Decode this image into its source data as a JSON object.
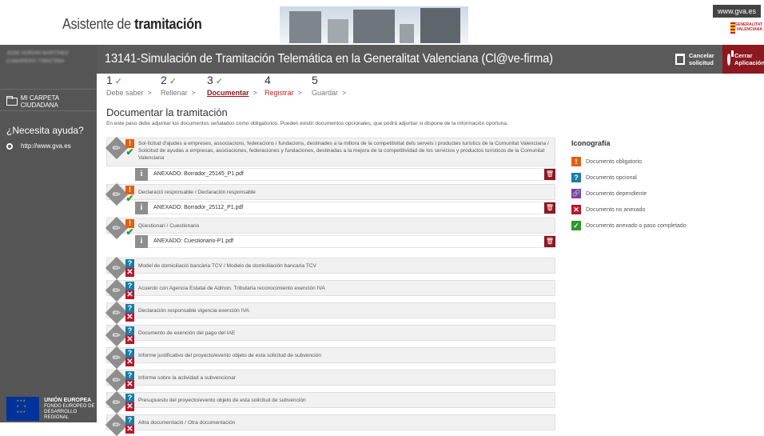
{
  "header": {
    "title_prefix": "Asistente de ",
    "title_bold": "tramitación",
    "gva_link": "www.gva.es",
    "gva_logo_line1": "GENERALITAT",
    "gva_logo_line2": "VALENCIANA"
  },
  "sidebar": {
    "user_name": "JOSE ADRIAN MARTINEZ CAMARERO 73942785A",
    "folder_label": "MI CARPETA CIUDADANA",
    "help_title": "¿Necesita ayuda?",
    "help_link": "http://www.gva.es",
    "eu_title": "UNIÓN EUROPEA",
    "eu_line1": "FONDO EUROPEO DE",
    "eu_line2": "DESARROLLO REGIONAL"
  },
  "titlebar": {
    "title": "13141-Simulación de Tramitación Telemática en la Generalitat Valenciana (Cl@ve-firma)",
    "cancel_line1": "Cancelar",
    "cancel_line2": "solicitud",
    "close_line1": "Cerrar",
    "close_line2": "Aplicación"
  },
  "steps": [
    {
      "num": "1",
      "check": "✓",
      "label": "Debe saber",
      "state": "done"
    },
    {
      "num": "2",
      "check": "✓",
      "label": "Rellenar",
      "state": "done"
    },
    {
      "num": "3",
      "check": "✓",
      "label": "Documentar",
      "state": "active"
    },
    {
      "num": "4",
      "check": "",
      "label": "Registrar",
      "state": "next"
    },
    {
      "num": "5",
      "check": "",
      "label": "Guardar",
      "state": "todo"
    }
  ],
  "section": {
    "title": "Documentar la tramitación",
    "description": "En este paso debe adjuntar los documentos señalados como obligatorios. Pueden existir documentos opcionales, que podrá adjuntar si dispone de la información oportuna."
  },
  "documents": [
    {
      "text": "Sol·licitud d'ajudes a empreses, associacions, federacions i fundacions, destinades a la millora de la competitivitat dels serveis i productes turístics de la Comunitat Valenciana / Solicitud de ayudas a empresas, asociaciones, federaciones y fundaciones, destinadas a la mejora de la competitividad de los servicios y productos turísticos de la Comunitat Valenciana",
      "type": "obligatorio",
      "status": "ok",
      "attachment": "ANEXADO: Borrador_25145_P1.pdf"
    },
    {
      "text": "Declaració responsable / Declaración responsable",
      "type": "obligatorio",
      "status": "ok",
      "attachment": "ANEXADO: Borrador_25112_P1.pdf"
    },
    {
      "text": "Qüestionari / Cuestionario",
      "type": "obligatorio",
      "status": "ok",
      "attachment": "ANEXADO: Cuestionario-P1.pdf"
    },
    {
      "text": "Model de domiciliació bancària TCV / Modelo de domiciliación bancaria TCV",
      "type": "opcional",
      "status": "no"
    },
    {
      "text": "Acuerdo con Agencia Estatal de Admon. Tributaria reconocimiento exención IVA",
      "type": "opcional",
      "status": "no"
    },
    {
      "text": "Declaración responsable vigencia exención IVA",
      "type": "opcional",
      "status": "no"
    },
    {
      "text": "Documento de exención del pago del IAE",
      "type": "opcional",
      "status": "no"
    },
    {
      "text": "Informe justificativo del proyecto/evento objeto de esta solicitud de subvención",
      "type": "opcional",
      "status": "no"
    },
    {
      "text": "Informe sobre la actividad a subvencionar",
      "type": "opcional",
      "status": "no"
    },
    {
      "text": "Presupuesto del proyecto/evento objeto de esta solicitud de subvención",
      "type": "opcional",
      "status": "no"
    },
    {
      "text": "Altra documentació / Otra documentación",
      "type": "opcional",
      "status": "no"
    }
  ],
  "legend": {
    "title": "Iconografía",
    "items": [
      {
        "icon": "exclamation-icon",
        "label": "Documento obligatorio"
      },
      {
        "icon": "question-icon",
        "label": "Documento opcional"
      },
      {
        "icon": "link-icon",
        "label": "Documento dependiente"
      },
      {
        "icon": "cross-icon",
        "label": "Documento no anexado"
      },
      {
        "icon": "check-icon",
        "label": "Documento anexado o paso completado"
      }
    ]
  },
  "colors": {
    "accent": "#8c1820",
    "sidebar": "#555555",
    "obligatorio": "#e06010",
    "opcional": "#1a7ca8",
    "dependiente": "#8a3c9c",
    "no_anexado": "#b8182a",
    "anexado": "#2a9a2a"
  }
}
